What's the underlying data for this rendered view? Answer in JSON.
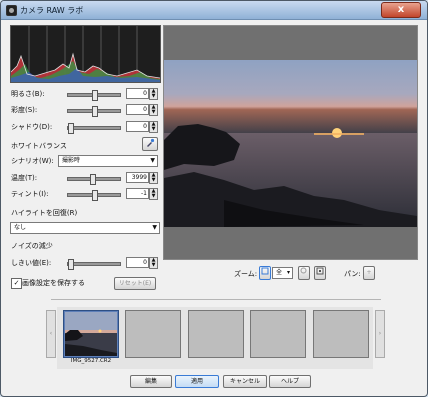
{
  "window": {
    "title": "カメラ RAW ラボ",
    "close": "x"
  },
  "adjustments": {
    "brightness": {
      "label": "明るさ(B):",
      "value": "0"
    },
    "contrast": {
      "label": "彩度(S):",
      "value": "0"
    },
    "sharpness": {
      "label": "シャドウ(D):",
      "value": "0"
    }
  },
  "white_balance": {
    "label": "ホワイトバランス",
    "scene_label": "シナリオ(W):",
    "scene_value": "撮影時",
    "temperature": {
      "label": "温度(T):",
      "value": "3999"
    },
    "tint": {
      "label": "ティント(I):",
      "value": "-1"
    }
  },
  "highlight": {
    "label": "ハイライトを回復(R)",
    "value": "なし"
  },
  "noise": {
    "label": "ノイズの減少",
    "threshold": {
      "label": "しきい値(E):",
      "value": "0"
    }
  },
  "save_settings": {
    "label": "画像設定を保存する",
    "checked": true,
    "reset": "リセット(E)"
  },
  "zoom": {
    "label": "ズーム:",
    "value": "全"
  },
  "pan": {
    "label": "パン:"
  },
  "thumbnails": [
    {
      "caption": "IMG_9527.CR2",
      "selected": true
    },
    {
      "caption": "",
      "selected": false
    },
    {
      "caption": "",
      "selected": false
    },
    {
      "caption": "",
      "selected": false
    },
    {
      "caption": "",
      "selected": false
    }
  ],
  "buttons": {
    "edit": "編集",
    "apply": "適用",
    "cancel": "キャンセル",
    "help": "ヘルプ"
  },
  "colors": {
    "accent": "#3a7bd5",
    "titlebar": "#8fb1d6"
  }
}
